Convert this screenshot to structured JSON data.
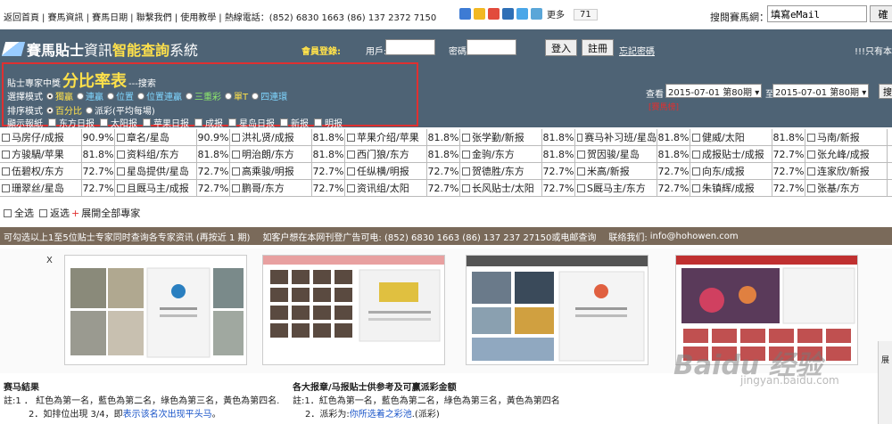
{
  "topbar": {
    "links": [
      "返回首頁",
      "賽馬資訊",
      "賽馬日期",
      "聯繫我們",
      "使用教學",
      "熱線電話：(852) 6830 1663 (86) 137 2372 7150"
    ],
    "share_more": "更多",
    "share_count": "71",
    "email_label": "搜閱賽馬網：",
    "email_placeholder": "填寫eMail",
    "email_button": "確"
  },
  "header": {
    "logo_part1": "賽馬貼士",
    "logo_part2": "資訊",
    "logo_part3": "智能查詢",
    "logo_part4": "系統",
    "member_label": "會員登錄:",
    "user_label": "用戶:",
    "pass_label": "密碼:",
    "login_button": "登入",
    "register_button": "註冊",
    "forgot_link": "忘記密碼",
    "only_text": "!!!只有本"
  },
  "panel": {
    "title_prefix": "貼士專家中獎",
    "title_big": "分比率表",
    "title_suffix": "---搜索",
    "mode_label": "選擇模式",
    "modes": [
      "獨贏",
      "連贏",
      "位置",
      "位置連贏",
      "三重彩",
      "單T",
      "四連環"
    ],
    "sort_label": "排序模式",
    "sort_options": [
      "百分比",
      "派彩(平均每場)"
    ],
    "show_label": "顯示報紙",
    "papers": [
      "东方日报",
      "太阳报",
      "苹果日报",
      "成报",
      "星岛日报",
      "新报",
      "明报"
    ]
  },
  "query": {
    "label": "查看",
    "from": "2015-07-01 第80期",
    "to_label": "至",
    "to": "2015-07-01 第80期",
    "button": "搜",
    "red_link": "[賽馬榜]"
  },
  "table": {
    "rows": [
      [
        [
          "马房仔/成报",
          "90.9%"
        ],
        [
          "章名/星岛",
          "90.9%"
        ],
        [
          "洪礼贤/成报",
          "81.8%"
        ],
        [
          "苹果介绍/苹果",
          "81.8%"
        ],
        [
          "张学勤/新报",
          "81.8%"
        ],
        [
          "赛马补习班/星岛",
          "81.8%"
        ],
        [
          "健威/太阳",
          "81.8%"
        ],
        [
          "马南/新报",
          ""
        ]
      ],
      [
        [
          "方骏騧/苹果",
          "81.8%"
        ],
        [
          "资料组/东方",
          "81.8%"
        ],
        [
          "明治朗/东方",
          "81.8%"
        ],
        [
          "西门狼/东方",
          "81.8%"
        ],
        [
          "金驹/东方",
          "81.8%"
        ],
        [
          "贺因骏/星岛",
          "81.8%"
        ],
        [
          "成报贴士/成报",
          "72.7%"
        ],
        [
          "张允峰/成报",
          ""
        ]
      ],
      [
        [
          "伍碧权/东方",
          "72.7%"
        ],
        [
          "星岛提供/星岛",
          "72.7%"
        ],
        [
          "高乘骏/明报",
          "72.7%"
        ],
        [
          "任纵横/明报",
          "72.7%"
        ],
        [
          "贺德胜/东方",
          "72.7%"
        ],
        [
          "米高/新报",
          "72.7%"
        ],
        [
          "向东/成报",
          "72.7%"
        ],
        [
          "连家欣/新报",
          ""
        ]
      ],
      [
        [
          "珊翠丝/星岛",
          "72.7%"
        ],
        [
          "且厩马主/成报",
          "72.7%"
        ],
        [
          "鹏哥/东方",
          "72.7%"
        ],
        [
          "资讯组/太阳",
          "72.7%"
        ],
        [
          "长风贴士/太阳",
          "72.7%"
        ],
        [
          "S厩马主/东方",
          "72.7%"
        ],
        [
          "朱镇辉/成报",
          "72.7%"
        ],
        [
          "张基/东方",
          ""
        ]
      ]
    ],
    "select_all": "全选",
    "select_back": "返选",
    "expand_all": "展開全部專家"
  },
  "infobar": {
    "text1": "可勾选以上1至5位贴士专家同时查询各专家资讯 (再按近 1 期)",
    "text2": "如客户想在本网刊登广告可电: (852) 6830 1663 (86) 137 237 27150或电邮查询",
    "text3": "联络我们:",
    "email": "info@hohowen.com"
  },
  "thumbs": {
    "close": "X"
  },
  "watermark": {
    "text": "Baidu 经验",
    "sub": "jingyan.baidu.com"
  },
  "section1": {
    "title": "赛马結果",
    "line1": "註:1 ． 紅色為第一名，藍色為第二名，綠色為第三名，黃色為第四名.",
    "line2_pre": "2．如排位出現 3/4，即",
    "line2_link": "表示该名次出现平头马",
    "line2_post": "。"
  },
  "section2": {
    "title": "各大报章/马报贴士供参考及可赢派彩金额",
    "line1": "註:1．紅色為第一名，藍色為第二名，綠色為第三名，黃色為第四名",
    "line2_pre": "2．派彩为:",
    "line2_link": "你所选着之彩池",
    "line2_post": ".(派彩)"
  },
  "sidebar": {
    "label": "展"
  }
}
